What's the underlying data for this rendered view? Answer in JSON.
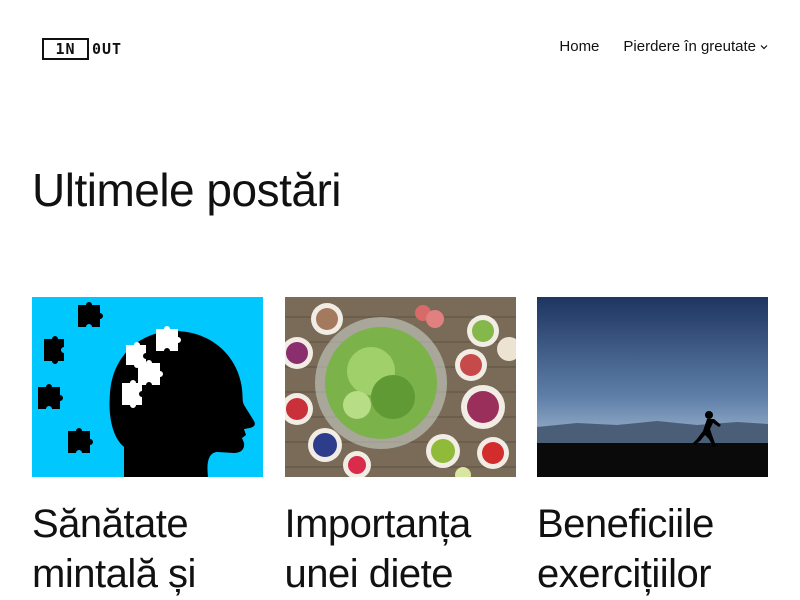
{
  "site": {
    "logo_boxed": "1N",
    "logo_tail": "0UT"
  },
  "nav": {
    "home_label": "Home",
    "dropdown_label": "Pierdere în greutate"
  },
  "main": {
    "title": "Ultimele postări"
  },
  "posts": [
    {
      "title": "Sănătate mintală și"
    },
    {
      "title": "Importanța unei diete"
    },
    {
      "title": "Beneficiile exercițiilor"
    }
  ],
  "colors": {
    "text": "#111111",
    "background": "#ffffff",
    "thumb_mind_bg": "#00c8ff",
    "thumb_salad_wood": "#7a6a58",
    "thumb_run_sky": "#3d5f8f"
  },
  "icons": {
    "dropdown": "chevron-down-icon"
  }
}
